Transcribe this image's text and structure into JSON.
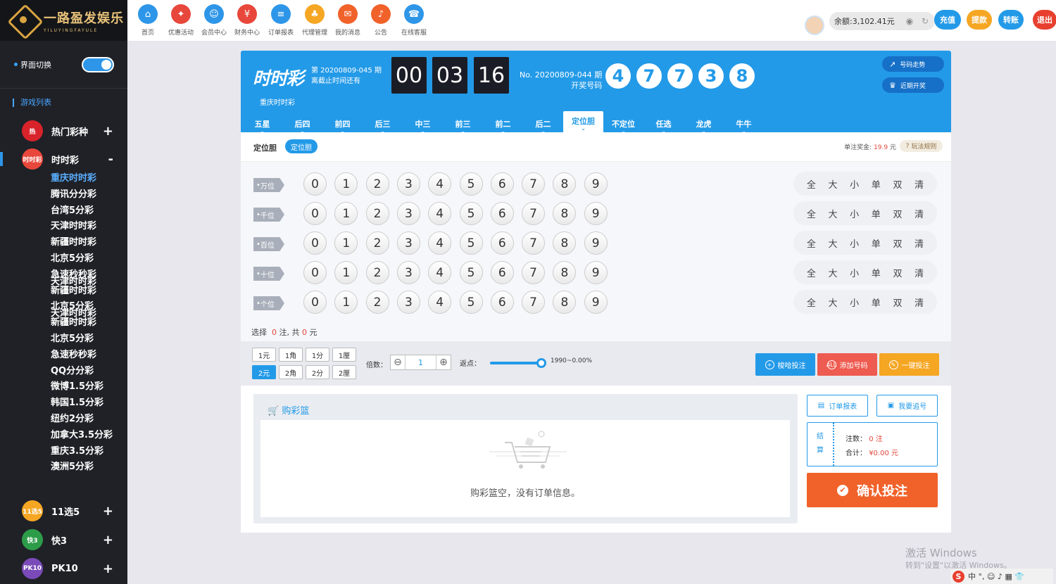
{
  "brand": {
    "title": "一路盈发娱乐",
    "subtitle": "YILUYINGFAYULE"
  },
  "sidebar": {
    "switch_label": "界面切换",
    "game_list_title": "游戏列表",
    "categories": [
      {
        "name": "热门彩种",
        "toggle": "+",
        "icon_text": "热",
        "color": "#d8232a"
      },
      {
        "name": "时时彩",
        "toggle": "-",
        "icon_text": "时时彩",
        "color": "#e8473b"
      },
      {
        "name": "11选5",
        "toggle": "+",
        "icon_text": "11选5",
        "color": "#f5a623"
      },
      {
        "name": "快3",
        "toggle": "+",
        "icon_text": "快3",
        "color": "#2d9c49"
      },
      {
        "name": "PK10",
        "toggle": "+",
        "icon_text": "PK10",
        "color": "#7a4bb8"
      }
    ],
    "sub_items": [
      "重庆时时彩",
      "腾讯分分彩",
      "台湾5分彩",
      "天津时时彩",
      "新疆时时彩",
      "北京5分彩",
      "急速秒秒彩",
      "新疆时时彩",
      "北京5分彩",
      "新疆时时彩",
      "北京5分彩",
      "急速秒秒彩",
      "QQ分分彩",
      "微博1.5分彩",
      "韩国1.5分彩",
      "纽约2分彩",
      "加拿大3.5分彩",
      "重庆3.5分彩",
      "澳洲5分彩"
    ],
    "overlap_items": [
      "天津时时彩",
      "天津时时彩"
    ]
  },
  "topnav": [
    {
      "label": "首页",
      "color": "#2e96e8",
      "glyph": "⌂"
    },
    {
      "label": "优惠活动",
      "color": "#e8473b",
      "glyph": "✦"
    },
    {
      "label": "会员中心",
      "color": "#2e96e8",
      "glyph": "☺"
    },
    {
      "label": "财务中心",
      "color": "#e8473b",
      "glyph": "¥"
    },
    {
      "label": "订单报表",
      "color": "#2e96e8",
      "glyph": "≡"
    },
    {
      "label": "代理管理",
      "color": "#f5a623",
      "glyph": "♣"
    },
    {
      "label": "我的消息",
      "color": "#f0622a",
      "glyph": "✉"
    },
    {
      "label": "公告",
      "color": "#f0622a",
      "glyph": "♪"
    },
    {
      "label": "在线客服",
      "color": "#2e96e8",
      "glyph": "☎"
    }
  ],
  "account": {
    "balance": "余额:3,102.41元",
    "buttons": [
      {
        "label": "充值",
        "color": "#239ae8"
      },
      {
        "label": "提款",
        "color": "#f5a623"
      },
      {
        "label": "转账",
        "color": "#239ae8"
      },
      {
        "label": "退出",
        "color": "#e8402f"
      }
    ]
  },
  "game": {
    "logo_text": "时时彩",
    "name": "重庆时时彩",
    "current_period": "第 20200809-045 期",
    "deadline_label": "离截止时间还有",
    "countdown": [
      "00",
      "03",
      "16"
    ],
    "last_period": "No. 20200809-044 期",
    "draw_label": "开奖号码",
    "draw_numbers": [
      "4",
      "7",
      "7",
      "3",
      "8"
    ],
    "trend_button": "号码走势",
    "recent_button": "近期开奖",
    "tabs": [
      "五星",
      "后四",
      "前四",
      "后三",
      "中三",
      "前三",
      "前二",
      "后二",
      "定位胆",
      "不定位",
      "任选",
      "龙虎",
      "牛牛"
    ],
    "active_tab": 8,
    "play_title": "定位胆",
    "play_pill": "定位胆",
    "prize_label": "单注奖金:",
    "prize_value": "19.9",
    "prize_unit": "元",
    "rule_label": "玩法规则",
    "positions": [
      "万位",
      "千位",
      "百位",
      "十位",
      "个位"
    ],
    "digits": [
      "0",
      "1",
      "2",
      "3",
      "4",
      "5",
      "6",
      "7",
      "8",
      "9"
    ],
    "quick_picks": [
      "全",
      "大",
      "小",
      "单",
      "双",
      "清"
    ],
    "selection": {
      "prefix": "选择",
      "count": "0",
      "mid": "注, 共",
      "amount": "0",
      "unit": "元"
    },
    "units_row1": [
      "1元",
      "1角",
      "1分",
      "1厘"
    ],
    "units_row2": [
      "2元",
      "2角",
      "2分",
      "2厘"
    ],
    "active_unit": "2元",
    "multiplier_label": "倍数：",
    "multiplier_value": "1",
    "rebate_label": "返点：",
    "rebate_value": "1990~0.00%",
    "rebate_level": 1.0,
    "actions": [
      {
        "label": "梭哈投注",
        "color": "#239ae8",
        "glyph": "+"
      },
      {
        "label": "添加号码",
        "color": "#ee5b50",
        "glyph": "ALL"
      },
      {
        "label": "一键投注",
        "color": "#f5a623",
        "glyph": "✎"
      }
    ]
  },
  "cart": {
    "title": "购彩篮",
    "empty_text": "购彩篮空，没有订单信息。",
    "report_button": "订单报表",
    "chase_button": "我要追号",
    "settle_label": [
      "结",
      "算"
    ],
    "bet_count_label": "注数：",
    "bet_count_value": "0 注",
    "total_label": "合计：",
    "total_value": "¥0.00 元",
    "confirm_button": "确认投注"
  },
  "watermark": {
    "line1": "激活 Windows",
    "line2": "转到\"设置\"以激活 Windows。"
  },
  "ime": {
    "logo": "S",
    "text": "中 °, ☺ ♪ ▦ 👕"
  }
}
